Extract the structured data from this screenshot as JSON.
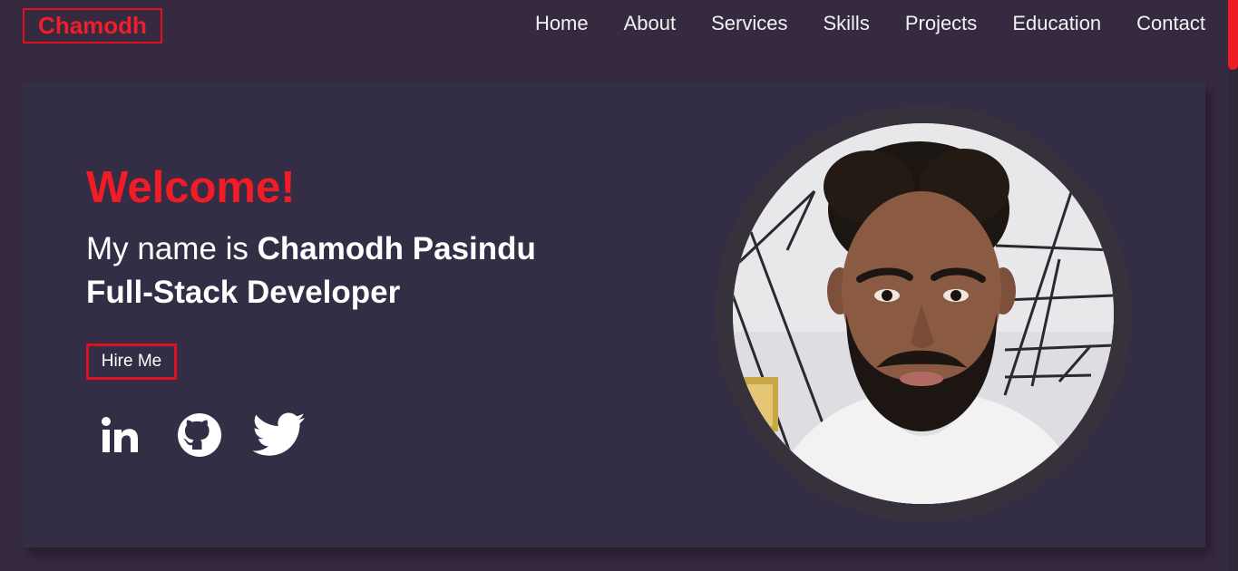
{
  "brand": "Chamodh",
  "nav": {
    "items": [
      "Home",
      "About",
      "Services",
      "Skills",
      "Projects",
      "Education",
      "Contact"
    ]
  },
  "hero": {
    "welcome": "Welcome!",
    "intro_prefix": "My name is ",
    "name": "Chamodh Pasindu",
    "role": "Full-Stack Developer",
    "hire_button": "Hire Me",
    "socials": [
      {
        "icon": "linkedin-icon"
      },
      {
        "icon": "github-icon"
      },
      {
        "icon": "twitter-icon"
      }
    ]
  },
  "colors": {
    "page_bg": "#362a40",
    "card_bg": "#332d45",
    "accent": "#f21c26",
    "text": "#ffffff"
  }
}
